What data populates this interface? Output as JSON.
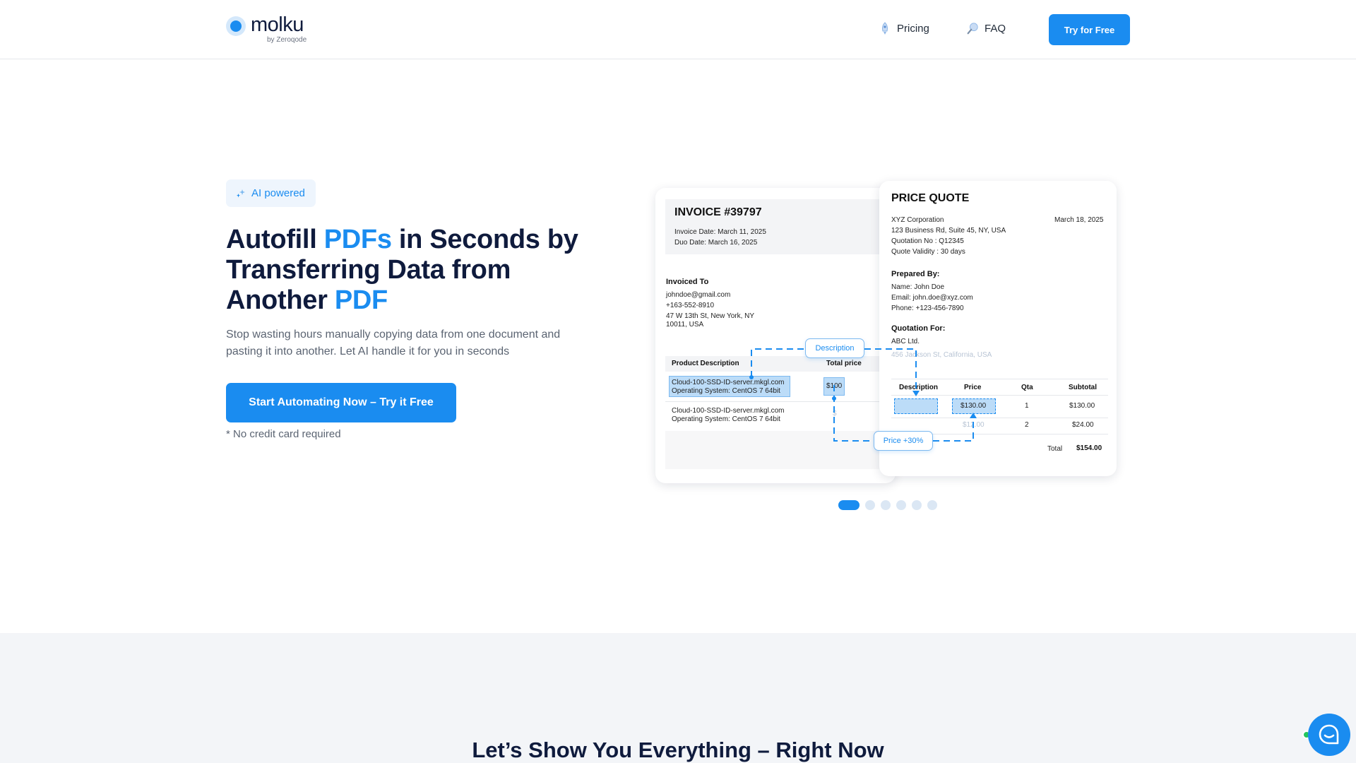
{
  "header": {
    "logo_text": "molku",
    "logo_sub": "by Zeroqode",
    "nav": [
      {
        "label": "Pricing",
        "icon": "pricing-icon"
      },
      {
        "label": "FAQ",
        "icon": "faq-icon"
      }
    ],
    "try_button": "Try for Free"
  },
  "hero": {
    "badge": "AI powered",
    "headline": {
      "part1": "Autofill ",
      "accent1": "PDFs",
      "part2": " in Seconds by Transferring Data from Another ",
      "accent2": "PDF"
    },
    "subtext": "Stop wasting hours manually copying data from one document and pasting it into another. Let AI handle it for you in seconds",
    "cta": "Start Automating Now – Try it Free",
    "note": "* No credit card required"
  },
  "invoice": {
    "title": "INVOICE #39797",
    "invoice_date": "Invoice Date: March 11, 2025",
    "due_date": "Duo Date: March 16, 2025",
    "invoiced_to_label": "Invoiced To",
    "email": "johndoe@gmail.com",
    "phone": "+163-552-8910",
    "address1": "47 W 13th St, New York, NY",
    "address2": "10011, USA",
    "col_desc": "Product Description",
    "col_total": "Total price",
    "rows": [
      {
        "line1": "Cloud-100-SSD-ID-server.mkgl.com",
        "line2": "Operating System: CentOS 7 64bit",
        "price": "$100"
      },
      {
        "line1": "Cloud-100-SSD-ID-server.mkgl.com",
        "line2": "Operating System: CentOS 7 64bit",
        "price": "$"
      }
    ]
  },
  "quote": {
    "title": "PRICE QUOTE",
    "company": "XYZ Corporation",
    "date": "March 18, 2025",
    "address": "123 Business Rd, Suite 45, NY, USA",
    "quotation_no": "Quotation No : Q12345",
    "validity": "Quote Validity : 30 days",
    "prepared_by_label": "Prepared By:",
    "name": "Name: John Doe",
    "email": "Email: john.doe@xyz.com",
    "phone": "Phone: +123-456-7890",
    "quotation_for_label": "Quotation For:",
    "client": "ABC Ltd.",
    "client_address": "456 Jackson St, California, USA",
    "cols": [
      "Description",
      "Price",
      "Qta",
      "Subtotal"
    ],
    "rows": [
      {
        "price": "$130.00",
        "qty": "1",
        "subtotal": "$130.00"
      },
      {
        "price": "$12.00",
        "qty": "2",
        "subtotal": "$24.00"
      }
    ],
    "total_label": "Total",
    "total_value": "$154.00"
  },
  "mapping": {
    "desc_pill": "Description",
    "price_pill": "Price +30%"
  },
  "carousel": {
    "count": 6,
    "active": 0
  },
  "section2": {
    "title": "Let’s Show You Everything – Right Now"
  },
  "colors": {
    "accent": "#1a8cf0",
    "heading": "#0f1b3d",
    "body": "#5b6472",
    "section_bg": "#f3f5f8"
  }
}
